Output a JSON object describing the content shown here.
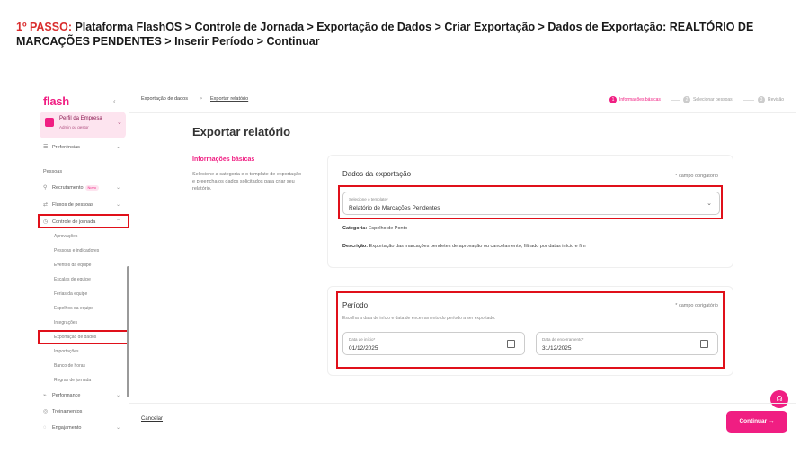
{
  "instruction": {
    "step": "1º PASSO:",
    "text": " Plataforma FlashOS > Controle de Jornada > Exportação de Dados > Criar Exportação >  Dados de Exportação:  REALTÓRIO DE MARCAÇÕES PENDENTES >  Inserir Período > Continuar"
  },
  "sidebar": {
    "logo": "flash",
    "collapse_icon": "chevron-left-icon",
    "profile": {
      "name": "Perfil da Empresa",
      "role": "Admin ou gestor"
    },
    "preferences": "Preferências",
    "section": "Pessoas",
    "items": [
      {
        "label": "Recrutamento",
        "badge": "Novo"
      },
      {
        "label": "Fluxos de pessoas"
      },
      {
        "label": "Controle de jornada"
      }
    ],
    "sub_items": [
      "Aprovações",
      "Pessoas e indicadores",
      "Eventos da equipe",
      "Escalas de equipe",
      "Férias da equipe",
      "Espelhos da equipe",
      "Integrações",
      "Exportação de dados",
      "Importações",
      "Banco de horas",
      "Regras de jornada"
    ],
    "bottom_items": [
      "Performance",
      "Treinamentos",
      "Engajamento"
    ]
  },
  "breadcrumb": {
    "first": "Exportação de dados",
    "separator": ">",
    "current": "Exportar relatório"
  },
  "stepper": [
    {
      "num": "1",
      "label": "Informações básicas"
    },
    {
      "num": "2",
      "label": "Selecionar pessoas"
    },
    {
      "num": "3",
      "label": "Revisão"
    }
  ],
  "page": {
    "title": "Exportar relatório",
    "section_title": "Informações básicas",
    "section_desc": "Selecione a categoria e o template de exportação e preencha os dados solicitados para criar seu relatório."
  },
  "export_card": {
    "title": "Dados da exportação",
    "required": "* campo obrigatório",
    "template_label": "Selecione o template*",
    "template_value": "Relatório de Marcações Pendentes",
    "category_label": "Categoria:",
    "category_value": " Espelho de Ponto",
    "description_label": "Descrição:",
    "description_value": " Exportação das marcações pendetes de aprovação ou cancelamento, filtrado por datas início e fim"
  },
  "period_card": {
    "title": "Período",
    "required": "* campo obrigatório",
    "desc": "Escolha a data de início e data de encerramento do período a ser exportado.",
    "start_label": "Data de início*",
    "start_value": "01/12/2025",
    "end_label": "Data de encerramento*",
    "end_value": "31/12/2025"
  },
  "footer": {
    "cancel": "Cancelar",
    "continue": "Continuar"
  },
  "colors": {
    "brand": "#f01e82",
    "highlight": "#e0101a"
  }
}
